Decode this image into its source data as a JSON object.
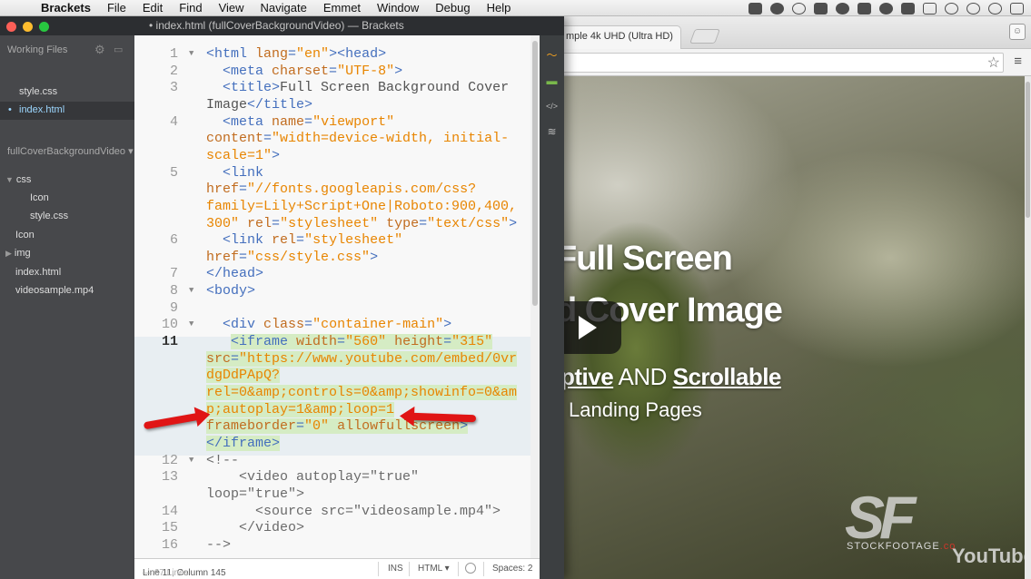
{
  "menubar": {
    "items": [
      "Brackets",
      "File",
      "Edit",
      "Find",
      "View",
      "Navigate",
      "Emmet",
      "Window",
      "Debug",
      "Help"
    ]
  },
  "window": {
    "title": "• index.html (fullCoverBackgroundVideo) — Brackets"
  },
  "sidebar": {
    "working_files_header": "Working Files",
    "working_files": [
      {
        "name": "style.css",
        "selected": false
      },
      {
        "name": "index.html",
        "selected": true
      }
    ],
    "project_name": "fullCoverBackgroundVideo",
    "tree": [
      {
        "label": "css",
        "level": 0,
        "folder": true
      },
      {
        "label": "Icon",
        "level": 1,
        "folder": false
      },
      {
        "label": "style.css",
        "level": 1,
        "folder": false
      },
      {
        "label": "Icon",
        "level": 0,
        "folder": false
      },
      {
        "label": "img",
        "level": 0,
        "folder": true
      },
      {
        "label": "index.html",
        "level": 0,
        "folder": false
      },
      {
        "label": "videosample.mp4",
        "level": 0,
        "folder": false
      }
    ]
  },
  "editor": {
    "line_numbers": [
      "1",
      "2",
      "3",
      "",
      "4",
      "",
      "",
      "5",
      "",
      "",
      "",
      "6",
      "",
      "7",
      "8",
      "9",
      "10",
      "11",
      "",
      "",
      "",
      "",
      "",
      "",
      "12",
      "13",
      "",
      "14",
      "15",
      "16"
    ],
    "lines": [
      [
        [
          "tag",
          "<html "
        ],
        [
          "att",
          "lang"
        ],
        [
          "tag",
          "="
        ],
        [
          "str",
          "\"en\""
        ],
        [
          "tag",
          "><head>"
        ]
      ],
      [
        [
          "txt",
          "  "
        ],
        [
          "tag",
          "<meta "
        ],
        [
          "att",
          "charset"
        ],
        [
          "tag",
          "="
        ],
        [
          "str",
          "\"UTF-8\""
        ],
        [
          "tag",
          ">"
        ]
      ],
      [
        [
          "txt",
          "  "
        ],
        [
          "tag",
          "<title>"
        ],
        [
          "txt",
          "Full Screen Background Cover"
        ]
      ],
      [
        [
          "txt",
          "Image"
        ],
        [
          "tag",
          "</title>"
        ]
      ],
      [
        [
          "txt",
          "  "
        ],
        [
          "tag",
          "<meta "
        ],
        [
          "att",
          "name"
        ],
        [
          "tag",
          "="
        ],
        [
          "str",
          "\"viewport\""
        ]
      ],
      [
        [
          "att",
          "content"
        ],
        [
          "tag",
          "="
        ],
        [
          "str",
          "\"width=device-width, initial-"
        ]
      ],
      [
        [
          "str",
          "scale=1\""
        ],
        [
          "tag",
          ">"
        ]
      ],
      [
        [
          "txt",
          "  "
        ],
        [
          "tag",
          "<link"
        ]
      ],
      [
        [
          "att",
          "href"
        ],
        [
          "tag",
          "="
        ],
        [
          "str",
          "\"//fonts.googleapis.com/css?"
        ]
      ],
      [
        [
          "str",
          "family=Lily+Script+One|Roboto:900,400,"
        ]
      ],
      [
        [
          "str",
          "300\""
        ],
        [
          "txt",
          " "
        ],
        [
          "att",
          "rel"
        ],
        [
          "tag",
          "="
        ],
        [
          "str",
          "\"stylesheet\""
        ],
        [
          "txt",
          " "
        ],
        [
          "att",
          "type"
        ],
        [
          "tag",
          "="
        ],
        [
          "str",
          "\"text/css\""
        ],
        [
          "tag",
          ">"
        ]
      ],
      [
        [
          "txt",
          "  "
        ],
        [
          "tag",
          "<link "
        ],
        [
          "att",
          "rel"
        ],
        [
          "tag",
          "="
        ],
        [
          "str",
          "\"stylesheet\""
        ]
      ],
      [
        [
          "att",
          "href"
        ],
        [
          "tag",
          "="
        ],
        [
          "str",
          "\"css/style.css\""
        ],
        [
          "tag",
          ">"
        ]
      ],
      [
        [
          "tag",
          "</head>"
        ]
      ],
      [
        [
          "tag",
          "<body>"
        ]
      ],
      [
        [
          "txt",
          ""
        ]
      ],
      [
        [
          "txt",
          "  "
        ],
        [
          "tag",
          "<div "
        ],
        [
          "att",
          "class"
        ],
        [
          "tag",
          "="
        ],
        [
          "str",
          "\"container-main\""
        ],
        [
          "tag",
          ">"
        ]
      ],
      [
        [
          "txt",
          "   "
        ],
        [
          "tag",
          "<iframe "
        ],
        [
          "att",
          "width"
        ],
        [
          "tag",
          "="
        ],
        [
          "str",
          "\"560\""
        ],
        [
          "txt",
          " "
        ],
        [
          "att",
          "height"
        ],
        [
          "tag",
          "="
        ],
        [
          "str",
          "\"315\""
        ]
      ],
      [
        [
          "att",
          "src"
        ],
        [
          "tag",
          "="
        ],
        [
          "str",
          "\"https://www.youtube.com/embed/0vr"
        ]
      ],
      [
        [
          "str",
          "dgDdPApQ?"
        ]
      ],
      [
        [
          "str",
          "rel=0&amp;controls=0&amp;showinfo=0&am"
        ]
      ],
      [
        [
          "str",
          "p;autoplay=1&amp;loop=1"
        ]
      ],
      [
        [
          "att",
          "frameborder"
        ],
        [
          "tag",
          "="
        ],
        [
          "str",
          "\"0\""
        ],
        [
          "txt",
          " "
        ],
        [
          "att",
          "allowfullscreen"
        ],
        [
          "tag",
          ">"
        ]
      ],
      [
        [
          "tag",
          "</iframe>"
        ]
      ],
      [
        [
          "com",
          "<!--"
        ]
      ],
      [
        [
          "com",
          "    <video autoplay=\"true\""
        ]
      ],
      [
        [
          "com",
          "loop=\"true\">"
        ]
      ],
      [
        [
          "com",
          "      <source src=\"videosample.mp4\">"
        ]
      ],
      [
        [
          "com",
          "    </video>"
        ]
      ],
      [
        [
          "com",
          "-->"
        ]
      ]
    ]
  },
  "statusbar": {
    "position": "Line 11, Column 145",
    "line_count": "— 67 Lines",
    "mode": "INS",
    "language": "HTML ▾",
    "spaces": "Spaces: 2"
  },
  "browser": {
    "tab_title": "mple 4k UHD (Ultra HD)",
    "hero_line1": "Full Screen",
    "hero_line2": "d Cover Image",
    "hero_line3_a": "ptive",
    "hero_line3_b": " AND ",
    "hero_line3_c": "Scrollable",
    "hero_line4": "Landing Pages",
    "watermark_logo": "SF",
    "watermark_text_a": "STOCKFOOTAGE",
    "watermark_text_b": ".co",
    "youtube_label": "YouTube"
  }
}
